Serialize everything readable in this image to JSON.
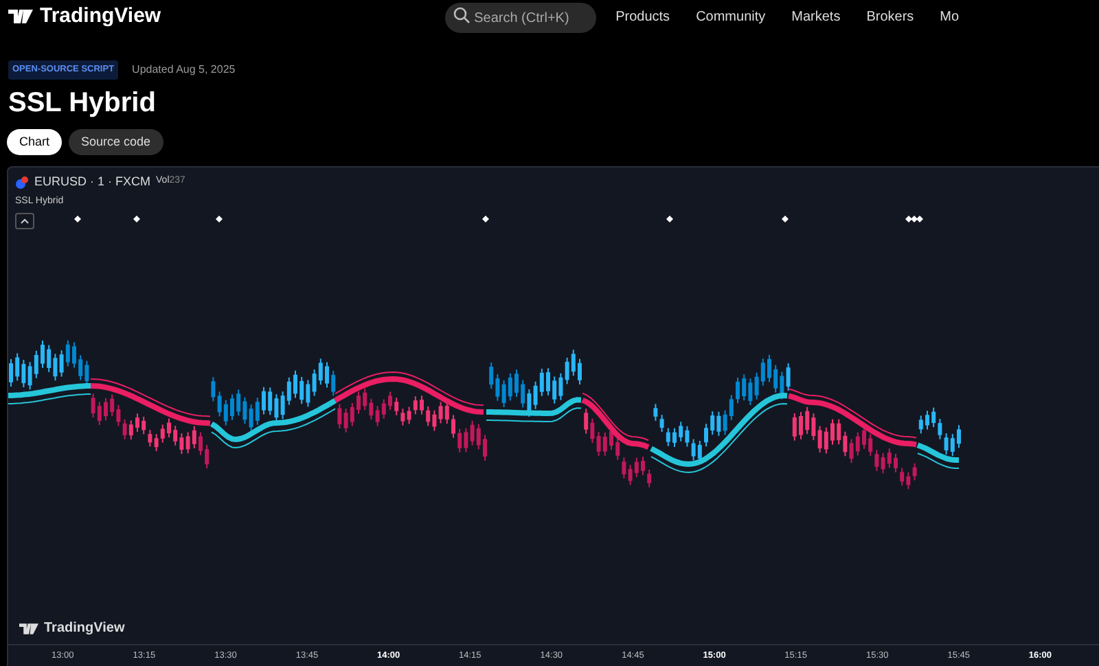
{
  "header": {
    "logo": "TradingView",
    "search": {
      "placeholder": "Search (Ctrl+K)"
    },
    "nav": [
      "Products",
      "Community",
      "Markets",
      "Brokers",
      "Mo"
    ]
  },
  "script": {
    "badge": "OPEN-SOURCE SCRIPT",
    "updated": "Updated Aug 5, 2025",
    "title": "SSL Hybrid"
  },
  "tabs": [
    {
      "label": "Chart",
      "selected": true
    },
    {
      "label": "Source code",
      "selected": false
    }
  ],
  "chart": {
    "symbol": "EURUSD · 1 · FXCM",
    "volume_label": "Vol",
    "volume": "237",
    "indicator": "SSL Hybrid",
    "watermark": "TradingView",
    "time_axis": [
      {
        "label": "13:00",
        "bold": false
      },
      {
        "label": "13:15",
        "bold": false
      },
      {
        "label": "13:30",
        "bold": false
      },
      {
        "label": "13:45",
        "bold": false
      },
      {
        "label": "14:00",
        "bold": true
      },
      {
        "label": "14:15",
        "bold": false
      },
      {
        "label": "14:30",
        "bold": false
      },
      {
        "label": "14:45",
        "bold": false
      },
      {
        "label": "15:00",
        "bold": true
      },
      {
        "label": "15:15",
        "bold": false
      },
      {
        "label": "15:30",
        "bold": false
      },
      {
        "label": "15:45",
        "bold": false
      },
      {
        "label": "16:00",
        "bold": true
      }
    ]
  }
}
